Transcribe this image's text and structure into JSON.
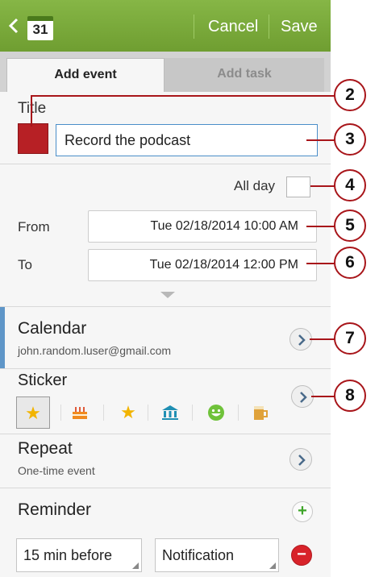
{
  "app_bar": {
    "calendar_icon_day": "31",
    "cancel_label": "Cancel",
    "save_label": "Save",
    "accent_color": "#7aad3b"
  },
  "tabs": [
    {
      "label": "Add event",
      "active": true
    },
    {
      "label": "Add task",
      "active": false
    }
  ],
  "title_section": {
    "label": "Title",
    "value": "Record the podcast",
    "color_swatch": "#b72025"
  },
  "all_day": {
    "label": "All day",
    "checked": false
  },
  "from": {
    "label": "From",
    "value": "Tue 02/18/2014  10:00 AM"
  },
  "to": {
    "label": "To",
    "value": "Tue 02/18/2014  12:00 PM"
  },
  "calendar": {
    "label": "Calendar",
    "account": "john.random.luser@gmail.com",
    "accent_color": "#5f96c8"
  },
  "sticker": {
    "label": "Sticker",
    "items": [
      "star-icon",
      "cake-icon",
      "star-icon",
      "bank-icon",
      "smiley-icon",
      "beer-mug-icon"
    ],
    "selected_index": 0
  },
  "repeat": {
    "label": "Repeat",
    "value": "One-time event"
  },
  "reminder": {
    "label": "Reminder",
    "time_option": "15 min before",
    "type_option": "Notification",
    "add_symbol": "+",
    "remove_symbol": "−"
  },
  "callouts": [
    "2",
    "3",
    "4",
    "5",
    "6",
    "7",
    "8"
  ]
}
